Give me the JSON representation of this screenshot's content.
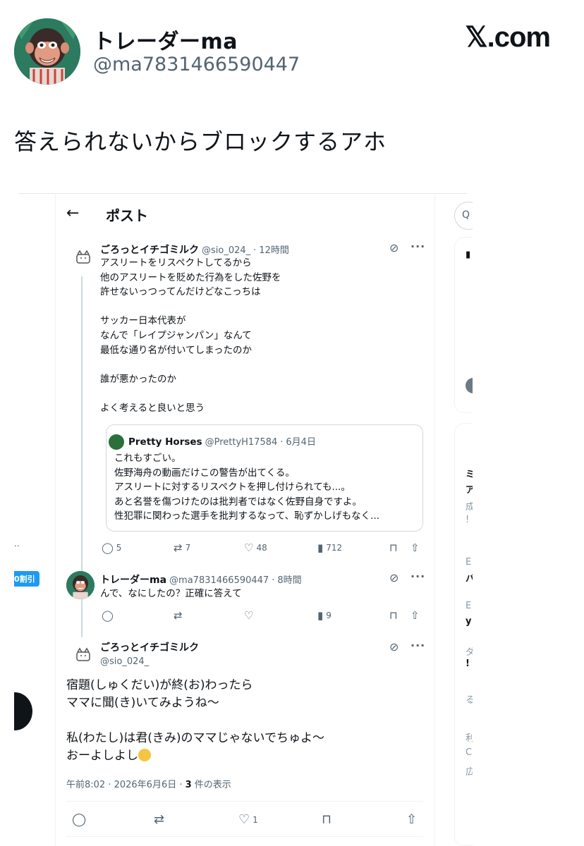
{
  "outer": {
    "name": "トレーダーma",
    "handle": "@ma7831466590447",
    "brand": "𝕏.com",
    "text": "答えられないからブロックするアホ"
  },
  "screen": {
    "title": "ポスト",
    "left_badge": "0割引",
    "left_dots": "..",
    "search_glyph": "Q",
    "sidebar_glyphs": [
      "ミ",
      "ア",
      "成",
      "!",
      "E",
      "バ",
      "E",
      "y",
      "ダ",
      "!",
      "る",
      "利",
      "C",
      "広"
    ]
  },
  "tweet1": {
    "name": "ごろっとイチゴミルク",
    "handle": "@sio_024_",
    "time": "12時間",
    "body": "アスリートをリスペクトしてるから\n他のアスリートを貶めた行為をした佐野を\n許せないっつってんだけどなこっちは\n\nサッカー日本代表が\nなんで「レイプジャンパン」なんて\n最低な通り名が付いてしまったのか\n\n誰が悪かったのか\n\nよく考えると良いと思う",
    "quote": {
      "name": "Pretty Horses",
      "handle": "@PrettyH17584",
      "date": "6月4日",
      "body": "これもすごい。\n佐野海舟の動画だけこの警告が出てくる。\nアスリートに対するリスペクトを押し付けられても...。\nあと名誉を傷つけたのは批判者ではなく佐野自身ですよ。\n性犯罪に関わった選手を批判するなって、恥ずかしげもなく..."
    },
    "replies": "5",
    "reposts": "7",
    "likes": "48",
    "views": "712"
  },
  "tweet2": {
    "name": "トレーダーma",
    "handle": "@ma7831466590447",
    "time": "8時間",
    "body": "んで、なにしたの？正確に答えて",
    "views": "9"
  },
  "main": {
    "name": "ごろっとイチゴミルク",
    "handle": "@sio_024_",
    "line1": "宿題(しゅくだい)が終(お)わったら",
    "line2": "ママに聞(き)いてみようね～",
    "line3": "私(わたし)は君(きみ)のママじゃないでちゅよ～",
    "line4": "おーよしよし",
    "timestamp": "午前8:02 · 2026年6月6日 · ",
    "views_count": "3",
    "views_label": " 件の表示",
    "likes": "1"
  },
  "icons": {
    "back": "back-arrow-icon",
    "grok": "grok-icon",
    "more": "more-icon",
    "reply": "reply-icon",
    "repost": "repost-icon",
    "like": "heart-icon",
    "views": "views-icon",
    "bookmark": "bookmark-icon",
    "share": "share-icon"
  }
}
